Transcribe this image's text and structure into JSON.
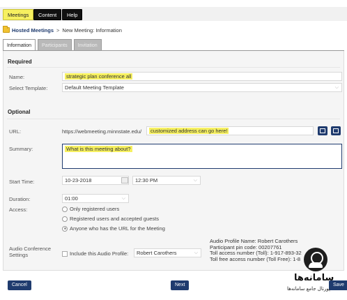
{
  "menu": {
    "items": [
      {
        "label": "Meetings",
        "active": true
      },
      {
        "label": "Content",
        "active": false
      },
      {
        "label": "Help",
        "active": false
      }
    ]
  },
  "breadcrumb": {
    "root": "Hosted Meetings",
    "separator": ">",
    "current": "New Meeting: Information"
  },
  "tabs": [
    {
      "label": "Information",
      "active": true
    },
    {
      "label": "Participants",
      "active": false
    },
    {
      "label": "Invitation",
      "active": false
    }
  ],
  "required": {
    "title": "Required",
    "name_label": "Name:",
    "name_value": "strategic plan conference all",
    "template_label": "Select Template:",
    "template_value": "Default Meeting Template"
  },
  "optional": {
    "title": "Optional",
    "url_label": "URL:",
    "url_prefix": "https://webmeeting.minnstate.edu/",
    "url_value": "customized address can go here!",
    "summary_label": "Summary:",
    "summary_value": "What is this meeting about?",
    "start_label": "Start Time:",
    "start_date": "10-23-2018",
    "start_time": "12:30 PM",
    "duration_label": "Duration:",
    "duration_value": "01:00",
    "access_label": "Access:",
    "access_options": [
      {
        "label": "Only registered users",
        "checked": false
      },
      {
        "label": "Registered users and accepted guests",
        "checked": false
      },
      {
        "label": "Anyone who has the URL for the Meeting",
        "checked": true
      }
    ],
    "audio_label": "Audio Conference Settings",
    "audio_checkbox_label": "Include this Audio Profile:",
    "audio_profile_value": "Robert Carothers",
    "audio_info": [
      "Audio Profile Name: Robert Carothers",
      "Participant pin code: 00207761",
      "Toll access number (Toll): 1-917-893-32",
      "Toll free access number (Toll Free): 1-8"
    ]
  },
  "buttons": {
    "cancel": "Cancel",
    "next": "Next",
    "save": "Save"
  },
  "watermark": {
    "title": "سامانه‌ها",
    "subtitle": "پورتال جامع سامانه‌ها"
  },
  "colors": {
    "highlight": "#f6f060",
    "navy": "#1f3b6e"
  }
}
